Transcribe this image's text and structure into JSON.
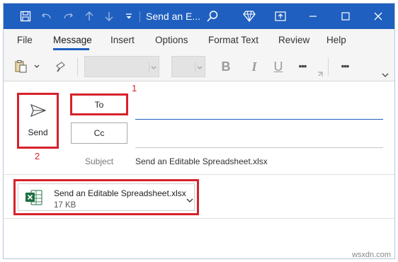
{
  "titlebar": {
    "title": "Send an E...",
    "bg_color": "#1f5fbf"
  },
  "tabs": [
    {
      "label": "File",
      "active": false
    },
    {
      "label": "Message",
      "active": true
    },
    {
      "label": "Insert",
      "active": false
    },
    {
      "label": "Options",
      "active": false
    },
    {
      "label": "Format Text",
      "active": false
    },
    {
      "label": "Review",
      "active": false
    },
    {
      "label": "Help",
      "active": false
    }
  ],
  "ribbon": {
    "bold": "B",
    "italic": "I",
    "underline": "U",
    "more1": "•••",
    "more2": "•••"
  },
  "compose": {
    "send_label": "Send",
    "to_label": "To",
    "cc_label": "Cc",
    "subject_label": "Subject",
    "subject_value": "Send an Editable Spreadsheet.xlsx",
    "to_value": "",
    "cc_value": ""
  },
  "annotations": {
    "one": "1",
    "two": "2",
    "color": "#d7222b"
  },
  "attachment": {
    "name": "Send an Editable Spreadsheet.xlsx",
    "size": "17 KB",
    "icon": "excel-icon"
  },
  "watermark": "wsxdn.com"
}
